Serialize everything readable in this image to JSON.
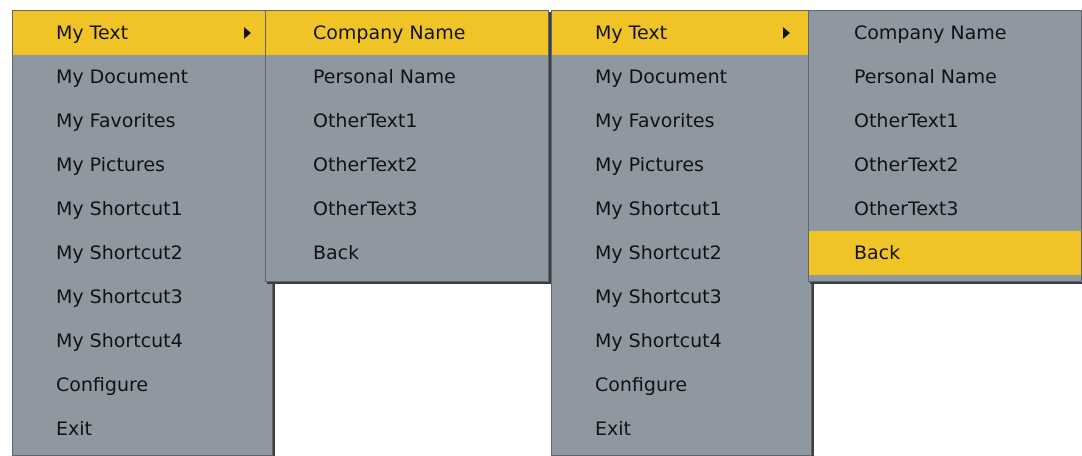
{
  "colors": {
    "menu_bg": "#8f97a0",
    "highlight": "#f0c426",
    "text": "#111111"
  },
  "main_menu": {
    "items": [
      {
        "label": "My Text",
        "has_submenu": true
      },
      {
        "label": "My Document"
      },
      {
        "label": "My Favorites"
      },
      {
        "label": "My Pictures"
      },
      {
        "label": "My Shortcut1"
      },
      {
        "label": "My Shortcut2"
      },
      {
        "label": "My Shortcut3"
      },
      {
        "label": "My Shortcut4"
      },
      {
        "label": "Configure"
      },
      {
        "label": "Exit"
      }
    ],
    "submenu_arrow_icon": "triangle-right-icon"
  },
  "submenu": {
    "items": [
      {
        "label": "Company Name"
      },
      {
        "label": "Personal Name"
      },
      {
        "label": "OtherText1"
      },
      {
        "label": "OtherText2"
      },
      {
        "label": "OtherText3"
      },
      {
        "label": "Back"
      }
    ]
  },
  "left_state": {
    "main_selected": "My Text",
    "sub_selected": "Company Name"
  },
  "right_state": {
    "main_selected": "My Text",
    "sub_selected": "Back"
  }
}
